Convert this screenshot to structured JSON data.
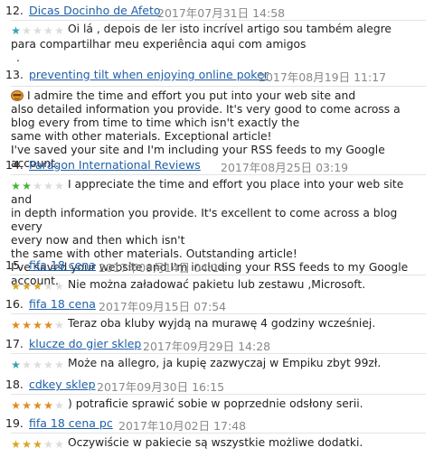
{
  "comments": [
    {
      "number": "12.",
      "author": "Dicas Docinho de Afeto",
      "date": "2017年07月31日 14:58",
      "rating": 1,
      "star_color": "#3a9fb5",
      "lines": [
        "Oi lá , depois de ler isto incrível artigo sou também alegre",
        "para compartilhar meu experiência aqui com amigos",
        "."
      ]
    },
    {
      "number": "13.",
      "author": "preventing tilt when enjoying online poker",
      "date": "2017年08月19日 11:17",
      "rating": 0,
      "avatar_icon": "emoji-face-icon",
      "lines": [
        "I admire the time and effort you put into your web site and",
        "also detailed information you provide. It's very good to come across a",
        "blog every from time to time which isn't exactly the",
        "same with other materials. Exceptional article!",
        "I've saved your site and I'm including your RSS feeds to my Google account."
      ]
    },
    {
      "number": "14.",
      "author": "Paragon International Reviews",
      "date": "2017年08月25日 03:19",
      "rating": 2,
      "star_color": "#4caf3c",
      "lines": [
        "I appreciate the time and effort you place into your web site and",
        "in depth information you provide. It's excellent to come across a blog every",
        "every now and then which isn't",
        "the same with other materials. Outstanding article!",
        "I've saved your website and I'm including your RSS feeds to my Google",
        "account."
      ]
    },
    {
      "number": "15.",
      "author": "fifa 18 cena",
      "date": "2017年09月14日 04:14",
      "rating": 3,
      "star_color": "#d8a521",
      "lines": [
        "Nie można załadować pakietu lub zestawu ,Microsoft."
      ]
    },
    {
      "number": "16.",
      "author": "fifa 18 cena",
      "date": "2017年09月15日 07:54",
      "rating": 4,
      "star_color": "#e08a1e",
      "lines": [
        "Teraz oba kluby wyjdą na murawę 4 godziny wcześniej."
      ]
    },
    {
      "number": "17.",
      "author": "klucze do gier sklep",
      "date": "2017年09月29日 14:28",
      "rating": 1,
      "star_color": "#3a9fb5",
      "lines": [
        "Może na allegro, ja kupię zazwyczaj w Empiku zbyt 99zł."
      ]
    },
    {
      "number": "18.",
      "author": "cdkey sklep",
      "date": "2017年09月30日 16:15",
      "rating": 4,
      "star_color": "#e08a1e",
      "lines": [
        ") potraficie sprawić sobie w poprzednie odsłony serii."
      ]
    },
    {
      "number": "19.",
      "author": "fifa 18 cena pc",
      "date": "2017年10月02日 17:48",
      "rating": 3,
      "star_color": "#d8a521",
      "lines": [
        "Oczywiście w pakiecie są wszystkie możliwe dodatki."
      ]
    }
  ]
}
